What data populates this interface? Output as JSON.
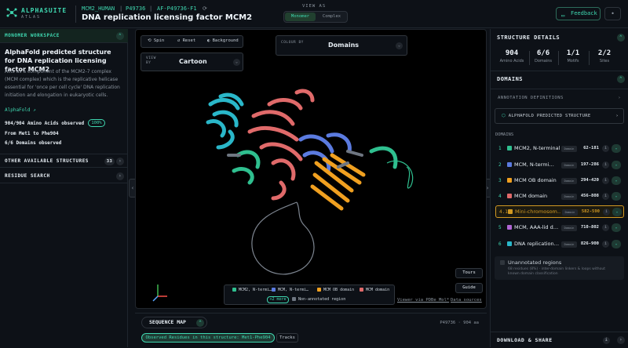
{
  "header": {
    "brand": "ALPHASUITE",
    "brand_sub": "ATLAS",
    "gene": "MCM2_HUMAN",
    "uniprot": "P49736",
    "af_id": "AF-P49736-F1",
    "title": "DNA replication licensing factor MCM2",
    "view_as_label": "VIEW AS",
    "view_as_options": [
      "Monomer",
      "Complex"
    ],
    "view_as_selected": "Monomer",
    "feedback_label": "Feedback"
  },
  "left": {
    "workspace_title": "MONOMER WORKSPACE",
    "protein_title": "AlphaFold predicted structure for DNA replication licensing factor MCM2",
    "description": "Acts as a component of the MCM2-7 complex (MCM complex) which is the replicative helicase essential for 'once per cell cycle' DNA replication initiation and elongation in eukaryotic cells.",
    "af_link": "AlphaFold ↗",
    "amino_acids": "904/904 Amino Acids observed",
    "pct": "100%",
    "range": "From Met1 to Phe904",
    "domains_observed": "6/6 Domains observed",
    "other_structures_label": "OTHER AVAILABLE STRUCTURES",
    "other_structures_count": "33",
    "residue_search_label": "RESIDUE SEARCH"
  },
  "viewer": {
    "spin_label": "Spin",
    "reset_label": "Reset",
    "background_label": "Background",
    "view_by_label": "VIEW BY",
    "view_by_value": "Cartoon",
    "colour_by_label": "COLOUR BY",
    "colour_by_value": "Domains",
    "legend": [
      {
        "label": "MCM2, N-termi…",
        "color": "#2fbf8f"
      },
      {
        "label": "MCM, N-termi…",
        "color": "#5b7be0"
      },
      {
        "label": "MCM OB domain",
        "color": "#f0a020"
      },
      {
        "label": "MCM domain",
        "color": "#e06a6a"
      }
    ],
    "more_label": "+2 more",
    "non_annotated_label": "Non-annotated region",
    "non_annotated_color": "#6e7681",
    "pdbe_link": "Viewer via PDBe Mol*",
    "data_sources_link": "Data sources",
    "tours_label": "Tours",
    "guide_label": "Guide"
  },
  "seqmap": {
    "title": "SEQUENCE MAP",
    "info": "P49736 · 904 aa",
    "observed": "Observed Residues in this structure: Met1-Phe904",
    "tracks": "Tracks"
  },
  "right": {
    "details_title": "STRUCTURE DETAILS",
    "stats": [
      {
        "value": "904",
        "label": "Amino Acids"
      },
      {
        "value": "6/6",
        "label": "Domains"
      },
      {
        "value": "1/1",
        "label": "Motifs"
      },
      {
        "value": "2/2",
        "label": "Sites"
      }
    ],
    "domains_title": "DOMAINS",
    "annotation_defs": "ANNOTATION DEFINITIONS",
    "af_structure": "ALPHAFOLD PREDICTED STRUCTURE",
    "domains_head": "DOMAINS",
    "domains": [
      {
        "idx": "1",
        "name": "MCM2, N-terminal",
        "tag": "Domain",
        "range": "62-181",
        "color": "#2fbf8f"
      },
      {
        "idx": "2",
        "name": "MCM, N-termi…",
        "tag": "Domain",
        "range": "197-286",
        "color": "#5b7be0"
      },
      {
        "idx": "3",
        "name": "MCM OB domain",
        "tag": "Domain",
        "range": "294-420",
        "color": "#f0a020"
      },
      {
        "idx": "4",
        "name": "MCM domain",
        "tag": "Domain",
        "range": "456-808",
        "color": "#e06a6a"
      },
      {
        "idx": "4.1",
        "name": "Mini-chromosom…",
        "tag": "Domain",
        "range": "582-590",
        "color": "#d29922"
      },
      {
        "idx": "5",
        "name": "MCM, AAA-lid d…",
        "tag": "Domain",
        "range": "710-802",
        "color": "#b066d6"
      },
      {
        "idx": "6",
        "name": "DNA replication…",
        "tag": "Domain",
        "range": "826-900",
        "color": "#2ab7c9"
      }
    ],
    "unannotated_title": "Unannotated regions",
    "unannotated_desc": "68 residues (8%) · inter-domain linkers & loops without known domain classification",
    "download_title": "DOWNLOAD & SHARE"
  }
}
